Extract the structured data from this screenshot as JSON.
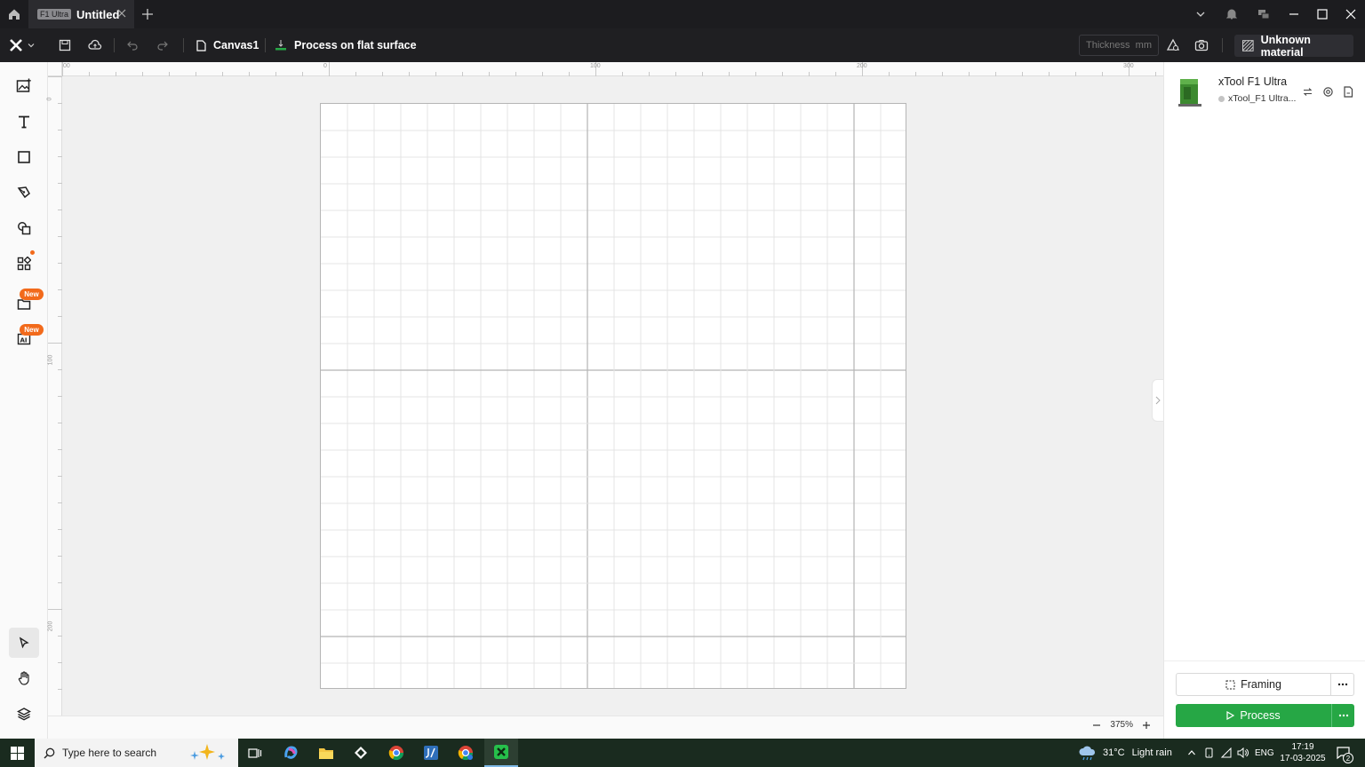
{
  "titlebar": {
    "tab_badge": "F1 Ultra",
    "tab_title": "Untitled"
  },
  "toolbar": {
    "canvas_name": "Canvas1",
    "process_mode": "Process on flat surface",
    "thickness_placeholder": "Thickness",
    "thickness_unit": "mm",
    "material_label": "Unknown material"
  },
  "left_tools": {
    "new_badge_1": "New",
    "new_badge_2": "New"
  },
  "rulers": {
    "top_ticks": [
      "00",
      "0",
      "100",
      "200",
      "300"
    ],
    "left_ticks": [
      "0",
      "100",
      "200"
    ]
  },
  "canvas": {
    "zoom": "375%"
  },
  "right_panel": {
    "device_name": "xTool F1 Ultra",
    "device_sub": "xTool_F1 Ultra...",
    "framing_label": "Framing",
    "process_label": "Process"
  },
  "taskbar": {
    "search_placeholder": "Type here to search",
    "weather_temp": "31°C",
    "weather_desc": "Light rain",
    "lang": "ENG",
    "time": "17:19",
    "date": "17-03-2025",
    "notif_count": "2"
  },
  "colors": {
    "accent_green": "#26a745",
    "badge_orange": "#f26a1b",
    "dark_bar": "#1c1c1f"
  }
}
